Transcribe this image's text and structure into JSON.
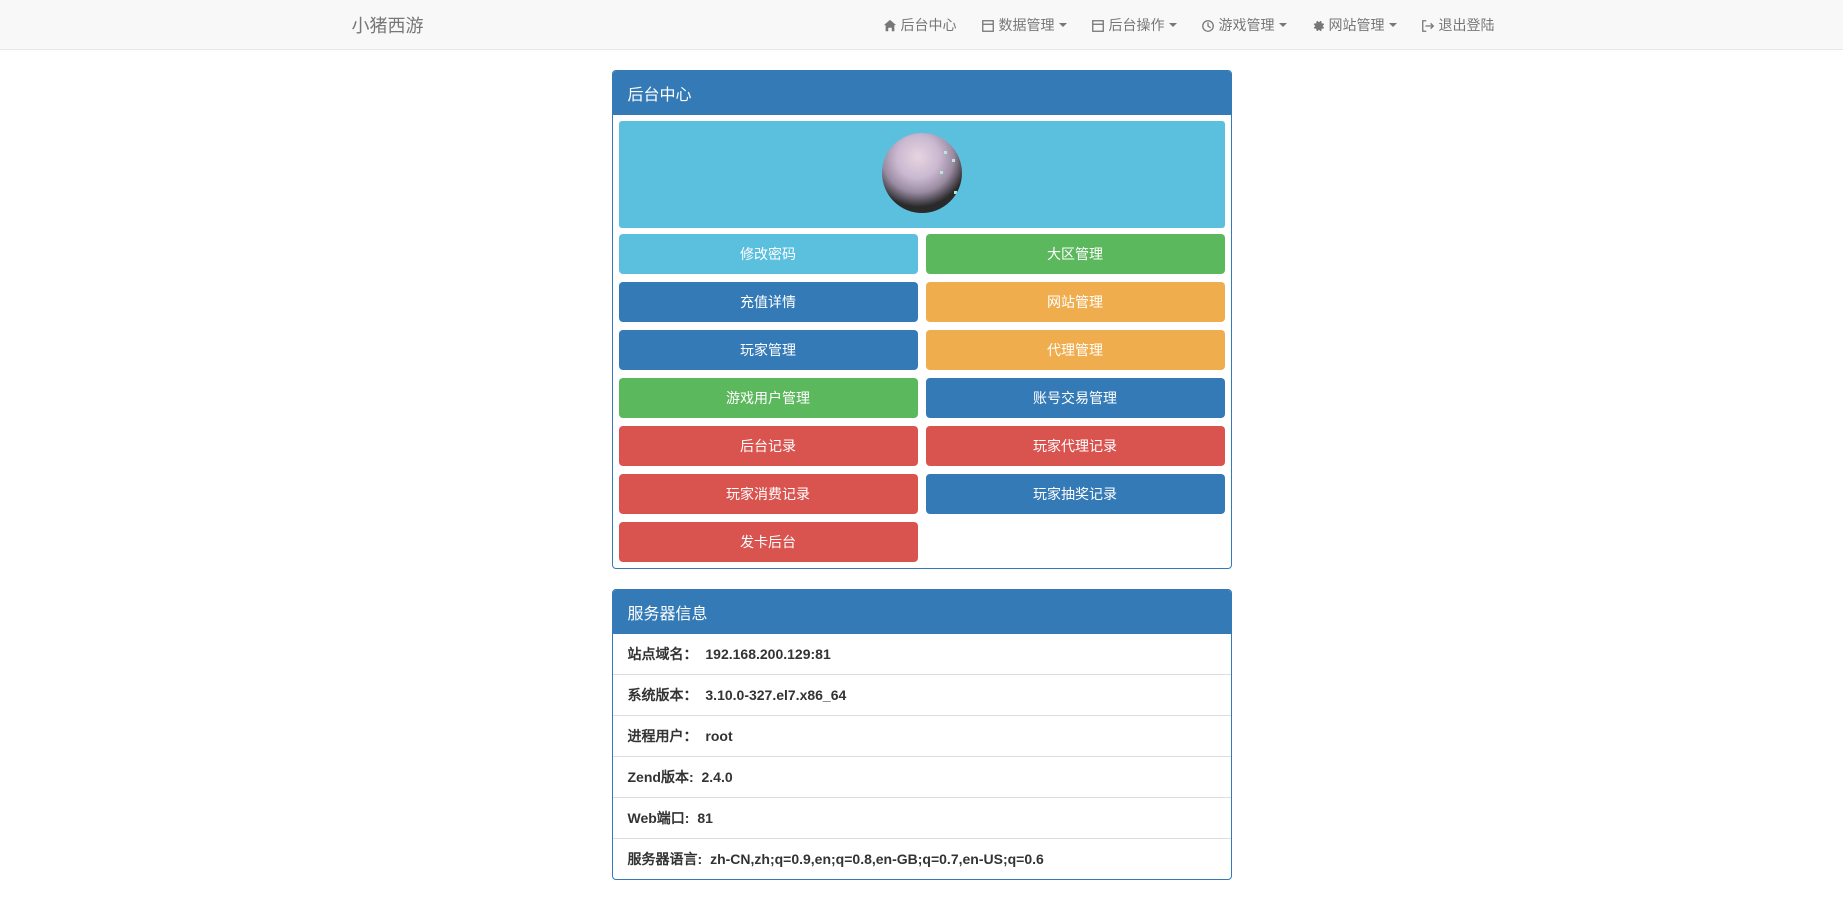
{
  "brand": "小猪西游",
  "nav": {
    "home": "后台中心",
    "data": "数据管理",
    "ops": "后台操作",
    "game": "游戏管理",
    "site": "网站管理",
    "logout": "退出登陆"
  },
  "panel1": {
    "title": "后台中心"
  },
  "buttons": {
    "change_password": "修改密码",
    "zone_manage": "大区管理",
    "recharge_detail": "充值详情",
    "site_manage": "网站管理",
    "player_manage": "玩家管理",
    "agent_manage": "代理管理",
    "game_user_manage": "游戏用户管理",
    "account_trade_manage": "账号交易管理",
    "backend_log": "后台记录",
    "player_agent_log": "玩家代理记录",
    "player_spend_log": "玩家消费记录",
    "player_lottery_log": "玩家抽奖记录",
    "card_backend": "发卡后台"
  },
  "panel2": {
    "title": "服务器信息"
  },
  "server": {
    "domain_label": "站点域名：",
    "domain_value": "192.168.200.129:81",
    "sys_label": "系统版本：",
    "sys_value": "3.10.0-327.el7.x86_64",
    "user_label": "进程用户：",
    "user_value": "root",
    "zend_label": "Zend版本:",
    "zend_value": "2.4.0",
    "port_label": "Web端口:",
    "port_value": "81",
    "lang_label": "服务器语言:",
    "lang_value": "zh-CN,zh;q=0.9,en;q=0.8,en-GB;q=0.7,en-US;q=0.6"
  }
}
